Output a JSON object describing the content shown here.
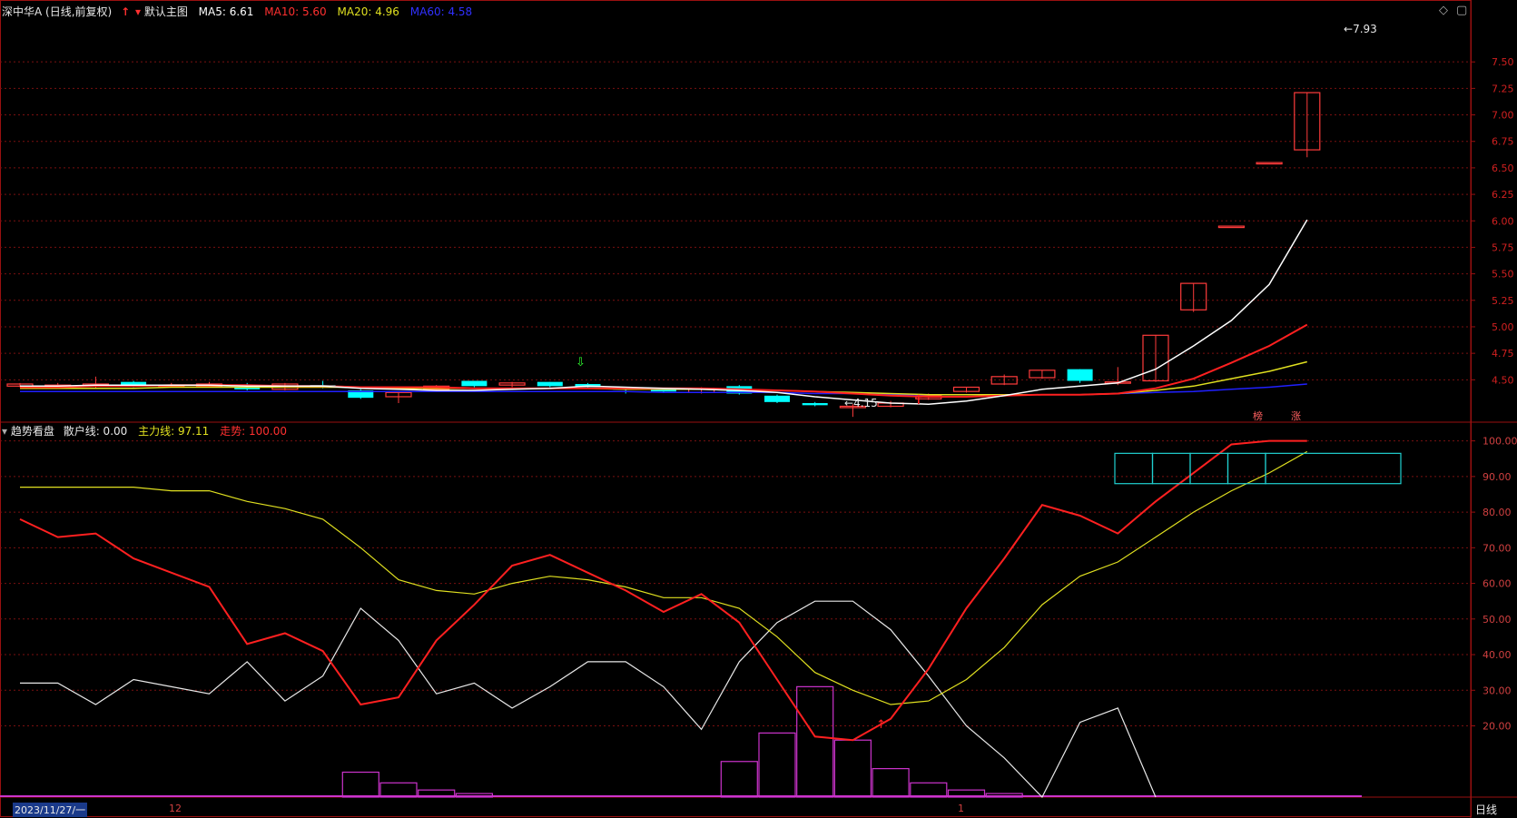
{
  "header_main": {
    "stock": "深中华A",
    "period": "(日线,前复权)",
    "template": "默认主图",
    "ma5": "MA5: 6.61",
    "ma10": "MA10: 5.60",
    "ma20": "MA20: 4.96",
    "ma60": "MA60: 4.58"
  },
  "header_ind": {
    "name": "趋势看盘",
    "retail": "散户线: 0.00",
    "main_force": "主力线: 97.11",
    "trend": "走势: 100.00"
  },
  "annotations": {
    "high_label": "7.93",
    "low_label": "4.15",
    "mark_1": "榜",
    "mark_2": "涨"
  },
  "x_axis": {
    "date_start": "2023/11/27/一",
    "month_12": "12",
    "month_1": "1"
  },
  "period_button": "日线",
  "colors": {
    "up": "#ff3b3b",
    "down": "#00ffff",
    "ma5": "#ffffff",
    "ma10": "#ff2020",
    "ma20": "#e0e020",
    "ma60": "#2020ff",
    "grid": "#7a1010",
    "hist": "#cc33cc"
  },
  "chart_data": [
    {
      "type": "candlestick",
      "ylim": [
        4.1,
        7.93
      ],
      "y_ticks": [
        "7.50",
        "7.25",
        "7.00",
        "6.75",
        "6.50",
        "6.25",
        "6.00",
        "5.75",
        "5.50",
        "5.25",
        "5.00",
        "4.75",
        "4.50"
      ],
      "candles": [
        {
          "o": 4.44,
          "c": 4.46,
          "h": 4.47,
          "l": 4.43
        },
        {
          "o": 4.44,
          "c": 4.45,
          "h": 4.47,
          "l": 4.42
        },
        {
          "o": 4.44,
          "c": 4.46,
          "h": 4.53,
          "l": 4.42
        },
        {
          "o": 4.48,
          "c": 4.45,
          "h": 4.49,
          "l": 4.43
        },
        {
          "o": 4.44,
          "c": 4.45,
          "h": 4.47,
          "l": 4.43
        },
        {
          "o": 4.44,
          "c": 4.46,
          "h": 4.48,
          "l": 4.43
        },
        {
          "o": 4.43,
          "c": 4.41,
          "h": 4.47,
          "l": 4.4
        },
        {
          "o": 4.41,
          "c": 4.46,
          "h": 4.47,
          "l": 4.4
        },
        {
          "o": 4.45,
          "c": 4.44,
          "h": 4.49,
          "l": 4.42
        },
        {
          "o": 4.4,
          "c": 4.33,
          "h": 4.41,
          "l": 4.32
        },
        {
          "o": 4.34,
          "c": 4.38,
          "h": 4.38,
          "l": 4.28
        },
        {
          "o": 4.41,
          "c": 4.44,
          "h": 4.45,
          "l": 4.4
        },
        {
          "o": 4.49,
          "c": 4.44,
          "h": 4.49,
          "l": 4.43
        },
        {
          "o": 4.45,
          "c": 4.47,
          "h": 4.48,
          "l": 4.43
        },
        {
          "o": 4.48,
          "c": 4.44,
          "h": 4.48,
          "l": 4.43
        },
        {
          "o": 4.46,
          "c": 4.43,
          "h": 4.47,
          "l": 4.42
        },
        {
          "o": 4.42,
          "c": 4.41,
          "h": 4.43,
          "l": 4.37
        },
        {
          "o": 4.41,
          "c": 4.39,
          "h": 4.42,
          "l": 4.38
        },
        {
          "o": 4.38,
          "c": 4.42,
          "h": 4.43,
          "l": 4.37
        },
        {
          "o": 4.44,
          "c": 4.37,
          "h": 4.45,
          "l": 4.36
        },
        {
          "o": 4.35,
          "c": 4.29,
          "h": 4.36,
          "l": 4.28
        },
        {
          "o": 4.28,
          "c": 4.26,
          "h": 4.29,
          "l": 4.25
        },
        {
          "o": 4.25,
          "c": 4.25,
          "h": 4.27,
          "l": 4.15
        },
        {
          "o": 4.25,
          "c": 4.28,
          "h": 4.3,
          "l": 4.24
        },
        {
          "o": 4.32,
          "c": 4.35,
          "h": 4.37,
          "l": 4.31
        },
        {
          "o": 4.39,
          "c": 4.43,
          "h": 4.43,
          "l": 4.38
        },
        {
          "o": 4.46,
          "c": 4.53,
          "h": 4.55,
          "l": 4.45
        },
        {
          "o": 4.52,
          "c": 4.59,
          "h": 4.59,
          "l": 4.51
        },
        {
          "o": 4.6,
          "c": 4.49,
          "h": 4.6,
          "l": 4.47
        },
        {
          "o": 4.48,
          "c": 4.48,
          "h": 4.62,
          "l": 4.45
        },
        {
          "o": 4.49,
          "c": 4.92,
          "h": 4.92,
          "l": 4.48
        },
        {
          "o": 5.16,
          "c": 5.41,
          "h": 5.41,
          "l": 5.14
        },
        {
          "o": 5.95,
          "c": 5.95,
          "h": 5.95,
          "l": 5.95
        },
        {
          "o": 6.55,
          "c": 6.55,
          "h": 6.55,
          "l": 6.55
        },
        {
          "o": 6.67,
          "c": 7.21,
          "h": 7.21,
          "l": 6.6
        }
      ],
      "ma5": [
        4.44,
        4.44,
        4.45,
        4.45,
        4.45,
        4.45,
        4.44,
        4.44,
        4.44,
        4.42,
        4.41,
        4.4,
        4.4,
        4.41,
        4.42,
        4.44,
        4.43,
        4.42,
        4.41,
        4.4,
        4.38,
        4.34,
        4.31,
        4.28,
        4.27,
        4.3,
        4.35,
        4.41,
        4.44,
        4.47,
        4.6,
        4.82,
        5.06,
        5.4,
        6.01
      ],
      "ma10": [
        4.43,
        4.43,
        4.44,
        4.44,
        4.45,
        4.45,
        4.45,
        4.44,
        4.44,
        4.43,
        4.43,
        4.43,
        4.42,
        4.42,
        4.42,
        4.42,
        4.42,
        4.42,
        4.42,
        4.41,
        4.4,
        4.39,
        4.37,
        4.35,
        4.34,
        4.34,
        4.35,
        4.36,
        4.36,
        4.37,
        4.42,
        4.51,
        4.66,
        4.82,
        5.02
      ],
      "ma20": [
        4.42,
        4.42,
        4.42,
        4.42,
        4.43,
        4.43,
        4.43,
        4.43,
        4.43,
        4.43,
        4.42,
        4.42,
        4.42,
        4.42,
        4.42,
        4.42,
        4.41,
        4.41,
        4.41,
        4.4,
        4.4,
        4.39,
        4.38,
        4.37,
        4.36,
        4.36,
        4.36,
        4.36,
        4.36,
        4.37,
        4.4,
        4.44,
        4.51,
        4.58,
        4.67
      ],
      "ma60": [
        4.39,
        4.39,
        4.39,
        4.39,
        4.39,
        4.39,
        4.39,
        4.39,
        4.39,
        4.39,
        4.39,
        4.39,
        4.39,
        4.39,
        4.39,
        4.39,
        4.39,
        4.38,
        4.38,
        4.38,
        4.38,
        4.37,
        4.37,
        4.36,
        4.36,
        4.36,
        4.36,
        4.36,
        4.36,
        4.37,
        4.38,
        4.39,
        4.41,
        4.43,
        4.46
      ]
    },
    {
      "type": "line",
      "ylim": [
        0,
        105
      ],
      "y_ticks": [
        "100.00",
        "90.00",
        "80.00",
        "70.00",
        "60.00",
        "50.00",
        "40.00",
        "30.00",
        "20.00"
      ],
      "series": [
        {
          "name": "散户线",
          "values": [
            32,
            32,
            26,
            33,
            31,
            29,
            38,
            27,
            34,
            53,
            44,
            29,
            32,
            25,
            31,
            38,
            38,
            31,
            19,
            38,
            49,
            55,
            55,
            47,
            34,
            20,
            11,
            0,
            21,
            25,
            0
          ]
        },
        {
          "name": "主力线",
          "values": [
            87,
            87,
            87,
            87,
            86,
            86,
            83,
            81,
            78,
            70,
            61,
            58,
            57,
            60,
            62,
            61,
            59,
            56,
            56,
            53,
            45,
            35,
            30,
            26,
            27,
            33,
            42,
            54,
            62,
            66,
            73,
            80,
            86,
            91,
            97
          ]
        },
        {
          "name": "走势",
          "values": [
            78,
            73,
            74,
            67,
            63,
            59,
            43,
            46,
            41,
            26,
            28,
            44,
            54,
            65,
            68,
            63,
            58,
            52,
            57,
            49,
            33,
            17,
            16,
            22,
            36,
            53,
            67,
            82,
            79,
            74,
            83,
            91,
            99,
            100,
            100
          ]
        }
      ],
      "histogram": [
        0,
        0,
        0,
        0,
        0,
        0,
        0,
        0,
        0,
        7,
        4,
        2,
        1,
        0,
        0,
        0,
        0,
        0,
        0,
        10,
        18,
        31,
        16,
        8,
        4,
        2,
        1,
        0,
        0,
        0,
        0,
        0,
        0,
        0,
        0
      ]
    }
  ]
}
